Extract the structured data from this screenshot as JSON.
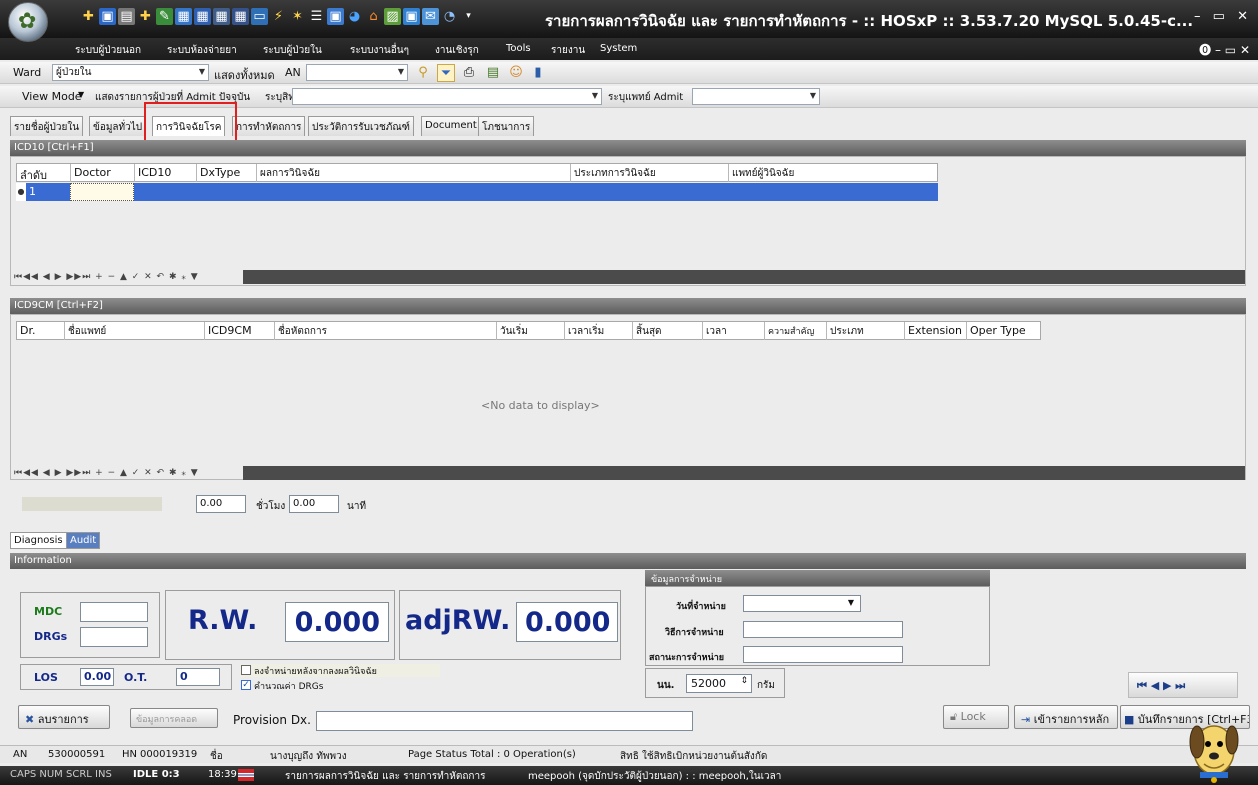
{
  "window": {
    "title": "รายการผลการวินิจฉัย และ รายการทำหัตถการ - :: HOSxP :: 3.53.7.20 MySQL 5.0.45-c...",
    "controls": "– ▭ ✕"
  },
  "menu": {
    "items": [
      "ระบบผู้ป่วยนอก",
      "ระบบห้องจ่ายยา",
      "ระบบผู้ป่วยใน",
      "ระบบงานอื่นๆ",
      "งานเชิงรุก",
      "Tools",
      "รายงาน",
      "System"
    ],
    "right": "⓿ – ▭ ✕"
  },
  "toolbar1": {
    "ward_label": "Ward",
    "ward_value": "ผู้ป่วยใน",
    "show_all": "แสดงทั้งหมด",
    "an_label": "AN"
  },
  "toolbar2": {
    "view_mode": "View Mode",
    "show_admit": "แสดงรายการผู้ป่วยที่ Admit ปัจจุบัน",
    "rights_label": "ระบุสิทธิ",
    "doctor_admit_label": "ระบุแพทย์ Admit"
  },
  "tabs": [
    "รายชื่อผู้ป่วยใน",
    "ข้อมูลทั่วไป",
    "การวินิจฉัยโรค",
    "การทำหัตถการ",
    "ประวัติการรับเวชภัณฑ์",
    "Document",
    "โภชนาการ"
  ],
  "icd10": {
    "header": "ICD10 [Ctrl+F1]",
    "columns": [
      "ลำดับ",
      "Doctor",
      "ICD10",
      "DxType",
      "ผลการวินิจฉัย",
      "ประเภทการวินิจฉัย",
      "แพทย์ผู้วินิจฉัย"
    ],
    "rows": [
      [
        "1",
        "",
        "",
        "",
        "",
        "",
        ""
      ]
    ]
  },
  "icd9": {
    "header": "ICD9CM [Ctrl+F2]",
    "columns": [
      "Dr.",
      "ชื่อแพทย์",
      "ICD9CM",
      "ชื่อหัตถการ",
      "วันเริ่ม",
      "เวลาเริ่ม",
      "สิ้นสุด",
      "เวลา",
      "ความสำคัญ",
      "ประเภท",
      "Extension",
      "Oper Type"
    ],
    "empty": "<No data to display>"
  },
  "nav_glyphs": "⏮◀◀ ◀ ▶ ▶▶⏭ + − ▲ ✓ ✕ ↶ ✱ ⁎ ▼",
  "duration": {
    "value1": "0.00",
    "hours_label": "ชั่วโมง",
    "value2": "0.00",
    "minutes_label": "นาที"
  },
  "bottom_tabs": [
    "Diagnosis",
    "Audit"
  ],
  "info": {
    "header": "Information",
    "mdc_label": "MDC",
    "drgs_label": "DRGs",
    "rw_label": "R.W.",
    "rw_value": "0.000",
    "adjrw_label": "adjRW.",
    "adjrw_value": "0.000",
    "los_label": "LOS",
    "los_value": "0.00",
    "ot_label": "O.T.",
    "ot_value": "0",
    "checkbox1": "ลงจำหน่ายหลังจากลงผลวินิจฉัย",
    "checkbox2": "คำนวณค่า DRGs",
    "checkbox2_checked": true
  },
  "discharge": {
    "header": "ข้อมูลการจำหน่าย",
    "date_label": "วันที่จำหน่าย",
    "method_label": "วิธีการจำหน่าย",
    "status_label": "สถานะการจำหน่าย",
    "weight_label": "นน.",
    "weight_value": "52000",
    "weight_unit": "กรัม"
  },
  "buttons": {
    "delete": "ลบรายการ",
    "extra": "ข้อมูลการคลอด",
    "provision_label": "Provision Dx.",
    "lock": "Lock",
    "to_main": "เข้ารายการหลัก",
    "save": "บันทึกรายการ [Ctrl+F3]"
  },
  "pager": "⏮  ◀  ▶  ⏭",
  "status1": {
    "an_label": "AN",
    "an_value": "530000591",
    "hn_label": "HN",
    "hn_value": "000019319",
    "name_label": "ชื่อ",
    "name_value": "นางบุญถึง ทัพพวง",
    "page_status": "Page Status  Total : 0 Operation(s)",
    "rights": "สิทธิ  ใช้สิทธิเบิกหน่วยงานต้นสังกัด"
  },
  "status2": {
    "keys": "CAPS  NUM  SCRL  INS",
    "idle": "IDLE 0:3",
    "time": "18:39",
    "title": "รายการผลการวินิจฉัย และ รายการทำหัตถการ",
    "user": "meepooh (จุดบักประวัติผู้ป่วยนอก) : : meepooh,ในเวลา"
  },
  "colors": {
    "selected_row": "#3a6bd2",
    "tab_highlight": "#e01f1f",
    "rw_text": "#14288a"
  }
}
